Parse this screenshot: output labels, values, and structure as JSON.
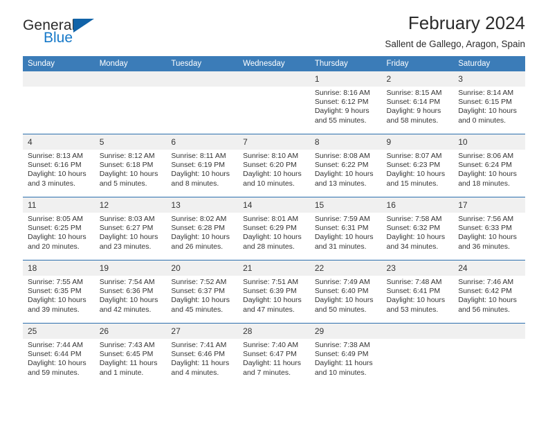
{
  "brand": {
    "name_top": "General",
    "name_bottom": "Blue",
    "mark": "triangle-logo"
  },
  "header": {
    "title": "February 2024",
    "subtitle": "Sallent de Gallego, Aragon, Spain"
  },
  "colors": {
    "header_blue": "#3b7cb8",
    "row_divider_blue": "#2a6ead",
    "daynum_band": "#f0f0f0",
    "brand_blue": "#1578c8",
    "text": "#333333"
  },
  "labels": {
    "sunrise": "Sunrise:",
    "sunset": "Sunset:",
    "daylight": "Daylight:"
  },
  "weekdays": [
    "Sunday",
    "Monday",
    "Tuesday",
    "Wednesday",
    "Thursday",
    "Friday",
    "Saturday"
  ],
  "weeks": [
    [
      {
        "day": ""
      },
      {
        "day": ""
      },
      {
        "day": ""
      },
      {
        "day": ""
      },
      {
        "day": "1",
        "sunrise": "Sunrise: 8:16 AM",
        "sunset": "Sunset: 6:12 PM",
        "daylight1": "Daylight: 9 hours",
        "daylight2": "and 55 minutes."
      },
      {
        "day": "2",
        "sunrise": "Sunrise: 8:15 AM",
        "sunset": "Sunset: 6:14 PM",
        "daylight1": "Daylight: 9 hours",
        "daylight2": "and 58 minutes."
      },
      {
        "day": "3",
        "sunrise": "Sunrise: 8:14 AM",
        "sunset": "Sunset: 6:15 PM",
        "daylight1": "Daylight: 10 hours",
        "daylight2": "and 0 minutes."
      }
    ],
    [
      {
        "day": "4",
        "sunrise": "Sunrise: 8:13 AM",
        "sunset": "Sunset: 6:16 PM",
        "daylight1": "Daylight: 10 hours",
        "daylight2": "and 3 minutes."
      },
      {
        "day": "5",
        "sunrise": "Sunrise: 8:12 AM",
        "sunset": "Sunset: 6:18 PM",
        "daylight1": "Daylight: 10 hours",
        "daylight2": "and 5 minutes."
      },
      {
        "day": "6",
        "sunrise": "Sunrise: 8:11 AM",
        "sunset": "Sunset: 6:19 PM",
        "daylight1": "Daylight: 10 hours",
        "daylight2": "and 8 minutes."
      },
      {
        "day": "7",
        "sunrise": "Sunrise: 8:10 AM",
        "sunset": "Sunset: 6:20 PM",
        "daylight1": "Daylight: 10 hours",
        "daylight2": "and 10 minutes."
      },
      {
        "day": "8",
        "sunrise": "Sunrise: 8:08 AM",
        "sunset": "Sunset: 6:22 PM",
        "daylight1": "Daylight: 10 hours",
        "daylight2": "and 13 minutes."
      },
      {
        "day": "9",
        "sunrise": "Sunrise: 8:07 AM",
        "sunset": "Sunset: 6:23 PM",
        "daylight1": "Daylight: 10 hours",
        "daylight2": "and 15 minutes."
      },
      {
        "day": "10",
        "sunrise": "Sunrise: 8:06 AM",
        "sunset": "Sunset: 6:24 PM",
        "daylight1": "Daylight: 10 hours",
        "daylight2": "and 18 minutes."
      }
    ],
    [
      {
        "day": "11",
        "sunrise": "Sunrise: 8:05 AM",
        "sunset": "Sunset: 6:25 PM",
        "daylight1": "Daylight: 10 hours",
        "daylight2": "and 20 minutes."
      },
      {
        "day": "12",
        "sunrise": "Sunrise: 8:03 AM",
        "sunset": "Sunset: 6:27 PM",
        "daylight1": "Daylight: 10 hours",
        "daylight2": "and 23 minutes."
      },
      {
        "day": "13",
        "sunrise": "Sunrise: 8:02 AM",
        "sunset": "Sunset: 6:28 PM",
        "daylight1": "Daylight: 10 hours",
        "daylight2": "and 26 minutes."
      },
      {
        "day": "14",
        "sunrise": "Sunrise: 8:01 AM",
        "sunset": "Sunset: 6:29 PM",
        "daylight1": "Daylight: 10 hours",
        "daylight2": "and 28 minutes."
      },
      {
        "day": "15",
        "sunrise": "Sunrise: 7:59 AM",
        "sunset": "Sunset: 6:31 PM",
        "daylight1": "Daylight: 10 hours",
        "daylight2": "and 31 minutes."
      },
      {
        "day": "16",
        "sunrise": "Sunrise: 7:58 AM",
        "sunset": "Sunset: 6:32 PM",
        "daylight1": "Daylight: 10 hours",
        "daylight2": "and 34 minutes."
      },
      {
        "day": "17",
        "sunrise": "Sunrise: 7:56 AM",
        "sunset": "Sunset: 6:33 PM",
        "daylight1": "Daylight: 10 hours",
        "daylight2": "and 36 minutes."
      }
    ],
    [
      {
        "day": "18",
        "sunrise": "Sunrise: 7:55 AM",
        "sunset": "Sunset: 6:35 PM",
        "daylight1": "Daylight: 10 hours",
        "daylight2": "and 39 minutes."
      },
      {
        "day": "19",
        "sunrise": "Sunrise: 7:54 AM",
        "sunset": "Sunset: 6:36 PM",
        "daylight1": "Daylight: 10 hours",
        "daylight2": "and 42 minutes."
      },
      {
        "day": "20",
        "sunrise": "Sunrise: 7:52 AM",
        "sunset": "Sunset: 6:37 PM",
        "daylight1": "Daylight: 10 hours",
        "daylight2": "and 45 minutes."
      },
      {
        "day": "21",
        "sunrise": "Sunrise: 7:51 AM",
        "sunset": "Sunset: 6:39 PM",
        "daylight1": "Daylight: 10 hours",
        "daylight2": "and 47 minutes."
      },
      {
        "day": "22",
        "sunrise": "Sunrise: 7:49 AM",
        "sunset": "Sunset: 6:40 PM",
        "daylight1": "Daylight: 10 hours",
        "daylight2": "and 50 minutes."
      },
      {
        "day": "23",
        "sunrise": "Sunrise: 7:48 AM",
        "sunset": "Sunset: 6:41 PM",
        "daylight1": "Daylight: 10 hours",
        "daylight2": "and 53 minutes."
      },
      {
        "day": "24",
        "sunrise": "Sunrise: 7:46 AM",
        "sunset": "Sunset: 6:42 PM",
        "daylight1": "Daylight: 10 hours",
        "daylight2": "and 56 minutes."
      }
    ],
    [
      {
        "day": "25",
        "sunrise": "Sunrise: 7:44 AM",
        "sunset": "Sunset: 6:44 PM",
        "daylight1": "Daylight: 10 hours",
        "daylight2": "and 59 minutes."
      },
      {
        "day": "26",
        "sunrise": "Sunrise: 7:43 AM",
        "sunset": "Sunset: 6:45 PM",
        "daylight1": "Daylight: 11 hours",
        "daylight2": "and 1 minute."
      },
      {
        "day": "27",
        "sunrise": "Sunrise: 7:41 AM",
        "sunset": "Sunset: 6:46 PM",
        "daylight1": "Daylight: 11 hours",
        "daylight2": "and 4 minutes."
      },
      {
        "day": "28",
        "sunrise": "Sunrise: 7:40 AM",
        "sunset": "Sunset: 6:47 PM",
        "daylight1": "Daylight: 11 hours",
        "daylight2": "and 7 minutes."
      },
      {
        "day": "29",
        "sunrise": "Sunrise: 7:38 AM",
        "sunset": "Sunset: 6:49 PM",
        "daylight1": "Daylight: 11 hours",
        "daylight2": "and 10 minutes."
      },
      {
        "day": ""
      },
      {
        "day": ""
      }
    ]
  ]
}
